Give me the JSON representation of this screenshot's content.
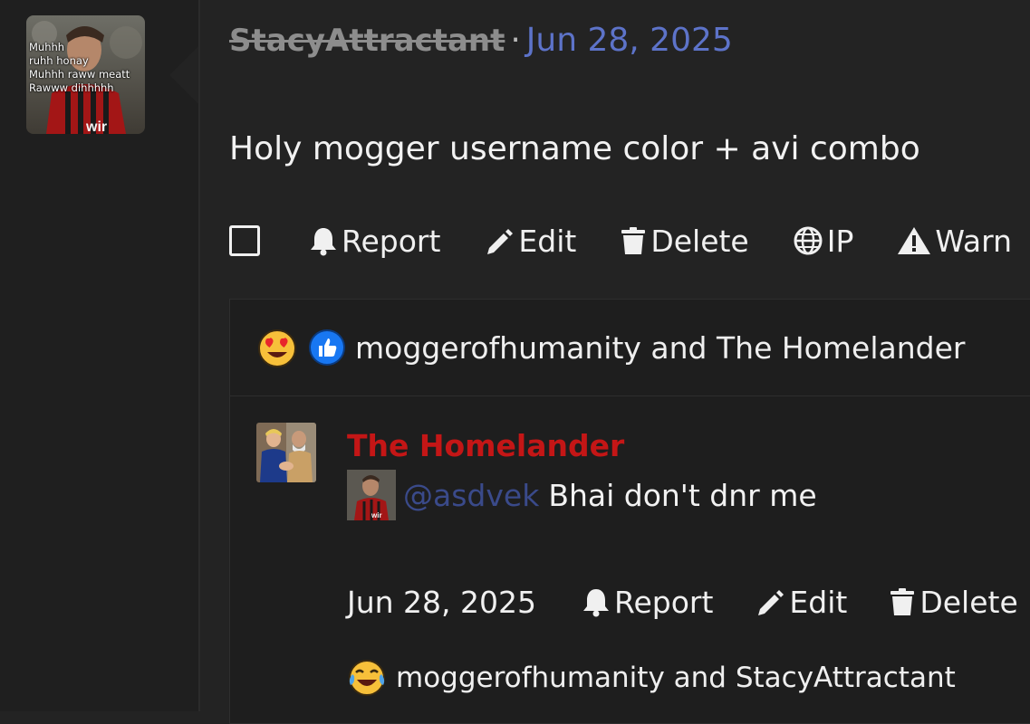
{
  "post": {
    "avatar_caption": "Muhhh\nruhh honay\nMuhhh raww meatt\nRawww dihhhhh",
    "username": "StacyAttractant",
    "separator": "·",
    "date": "Jun 28, 2025",
    "body": "Holy mogger username color + avi combo"
  },
  "actions": {
    "report": "Report",
    "edit": "Edit",
    "delete": "Delete",
    "ip": "IP",
    "warn": "Warn"
  },
  "reactions": {
    "icons": [
      "heart-eyes-emoji-icon",
      "thumbs-up-icon"
    ],
    "text": "moggerofhumanity and The Homelander"
  },
  "comment": {
    "author": "The Homelander",
    "mention": "@asdvek",
    "text": "Bhai don't dnr me",
    "date": "Jun 28, 2025",
    "report": "Report",
    "edit": "Edit",
    "delete": "Delete",
    "reaction_icon": "crying-laughing-emoji-icon",
    "reaction_text": "moggerofhumanity and StacyAttractant"
  },
  "colors": {
    "author_red": "#c41616",
    "date_blue": "#5d73c9",
    "mention_blue": "#3a4a8a"
  }
}
